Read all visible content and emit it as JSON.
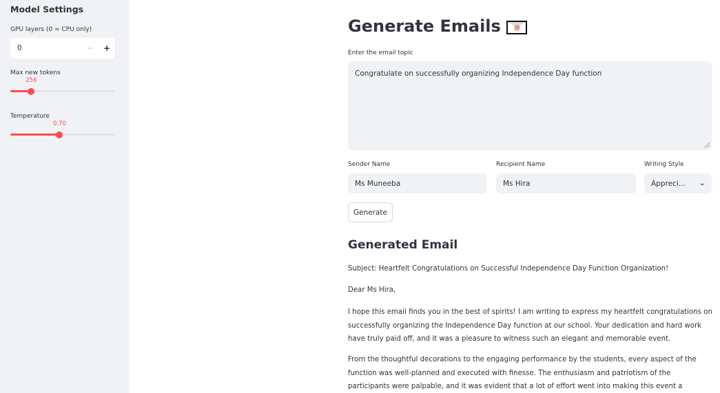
{
  "sidebar": {
    "title": "Model Settings",
    "gpu_layers": {
      "label": "GPU layers (0 = CPU only)",
      "value": "0",
      "minus": "−",
      "plus": "+"
    },
    "max_new_tokens": {
      "label": "Max new tokens",
      "value": "256",
      "fraction": 0.2
    },
    "temperature": {
      "label": "Temperature",
      "value": "0.70",
      "fraction": 0.47
    }
  },
  "main": {
    "title": "Generate Emails",
    "title_icon": "envelope-icon",
    "title_icon_glyph": "@",
    "topic": {
      "label": "Enter the email topic",
      "value": "Congratulate on successfully organizing Independence Day function"
    },
    "sender": {
      "label": "Sender Name",
      "value": "Ms Muneeba"
    },
    "recipient": {
      "label": "Recipient Name",
      "value": "Ms Hira"
    },
    "style": {
      "label": "Writing Style",
      "value": "Appreci..."
    },
    "generate_label": "Generate",
    "generated": {
      "heading": "Generated Email",
      "subject": "Subject: Heartfelt Congratulations on Successful Independence Day Function Organization!",
      "greeting": "Dear Ms Hira,",
      "para1": "I hope this email finds you in the best of spirits! I am writing to express my heartfelt congratulations on successfully organizing the Independence Day function at our school. Your dedication and hard work have truly paid off, and it was a pleasure to witness such an elegant and memorable event.",
      "para2": "From the thoughtful decorations to the engaging performance by the students, every aspect of the function was well-planned and executed with finesse. The enthusiasm and patriotism of the participants were palpable, and it was evident that a lot of effort went into making this event a success."
    }
  },
  "colors": {
    "accent": "#ff4b4b",
    "sidebar_bg": "#f0f2f6",
    "text": "#31333f"
  }
}
